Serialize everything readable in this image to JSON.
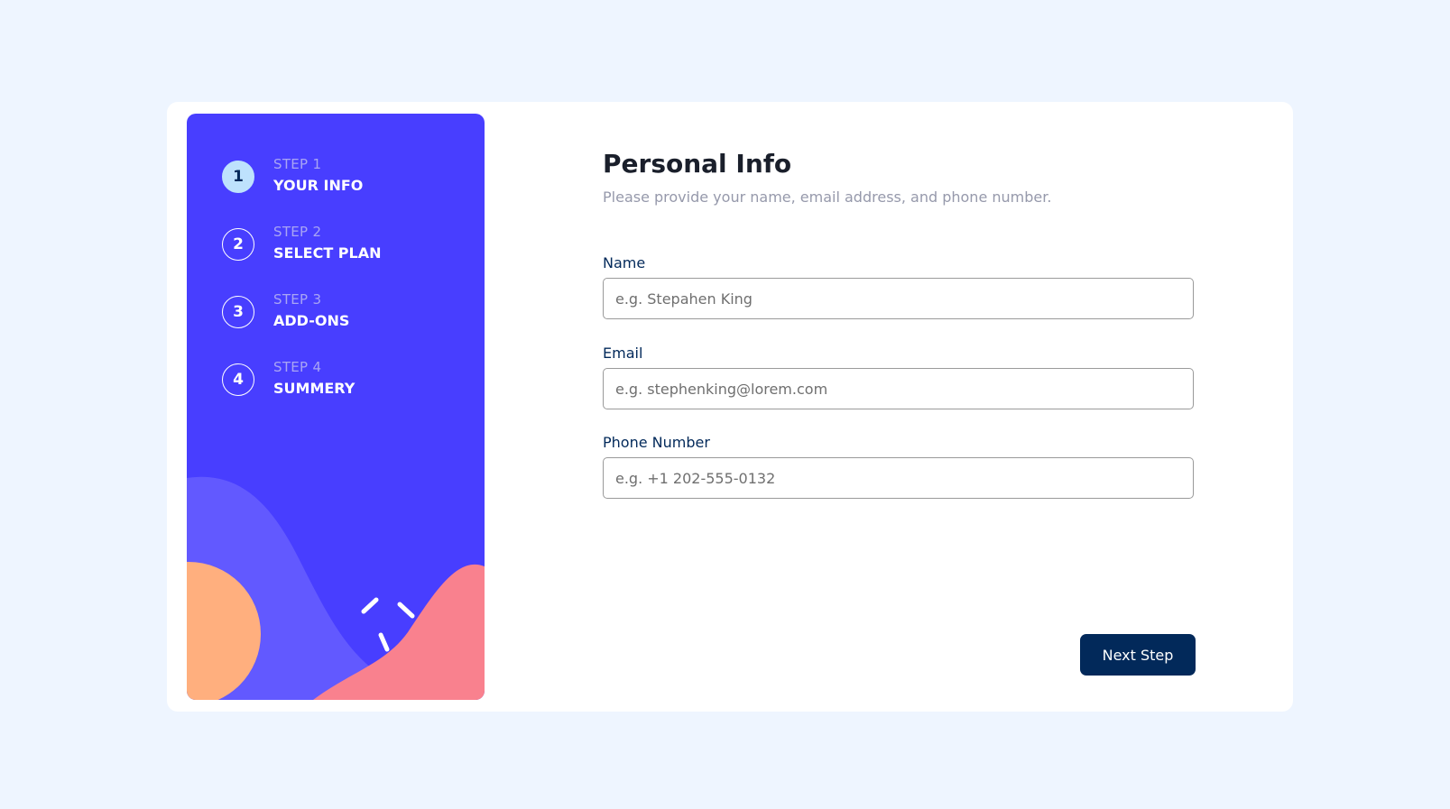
{
  "sidebar": {
    "steps": [
      {
        "number": "1",
        "kicker": "STEP 1",
        "title": "YOUR INFO",
        "active": true
      },
      {
        "number": "2",
        "kicker": "STEP 2",
        "title": "SELECT PLAN",
        "active": false
      },
      {
        "number": "3",
        "kicker": "STEP 3",
        "title": "ADD-ONS",
        "active": false
      },
      {
        "number": "4",
        "kicker": "STEP 4",
        "title": "SUMMERY",
        "active": false
      }
    ]
  },
  "main": {
    "title": "Personal Info",
    "subtitle": "Please provide your name, email address, and phone number.",
    "fields": {
      "name": {
        "label": "Name",
        "placeholder": "e.g. Stepahen King",
        "value": ""
      },
      "email": {
        "label": "Email",
        "placeholder": "e.g. stephenking@lorem.com",
        "value": ""
      },
      "phone": {
        "label": "Phone Number",
        "placeholder": "e.g. +1 202-555-0132",
        "value": ""
      }
    },
    "next_label": "Next Step"
  },
  "colors": {
    "page_background": "#eef5ff",
    "sidebar_purple": "#483eff",
    "active_step": "#bee2fd",
    "marine_blue": "#02295a",
    "cool_gray": "#9699ab",
    "blob_light_purple": "#6259ff",
    "blob_orange": "#ffaf7e",
    "blob_pink": "#f9818e"
  }
}
